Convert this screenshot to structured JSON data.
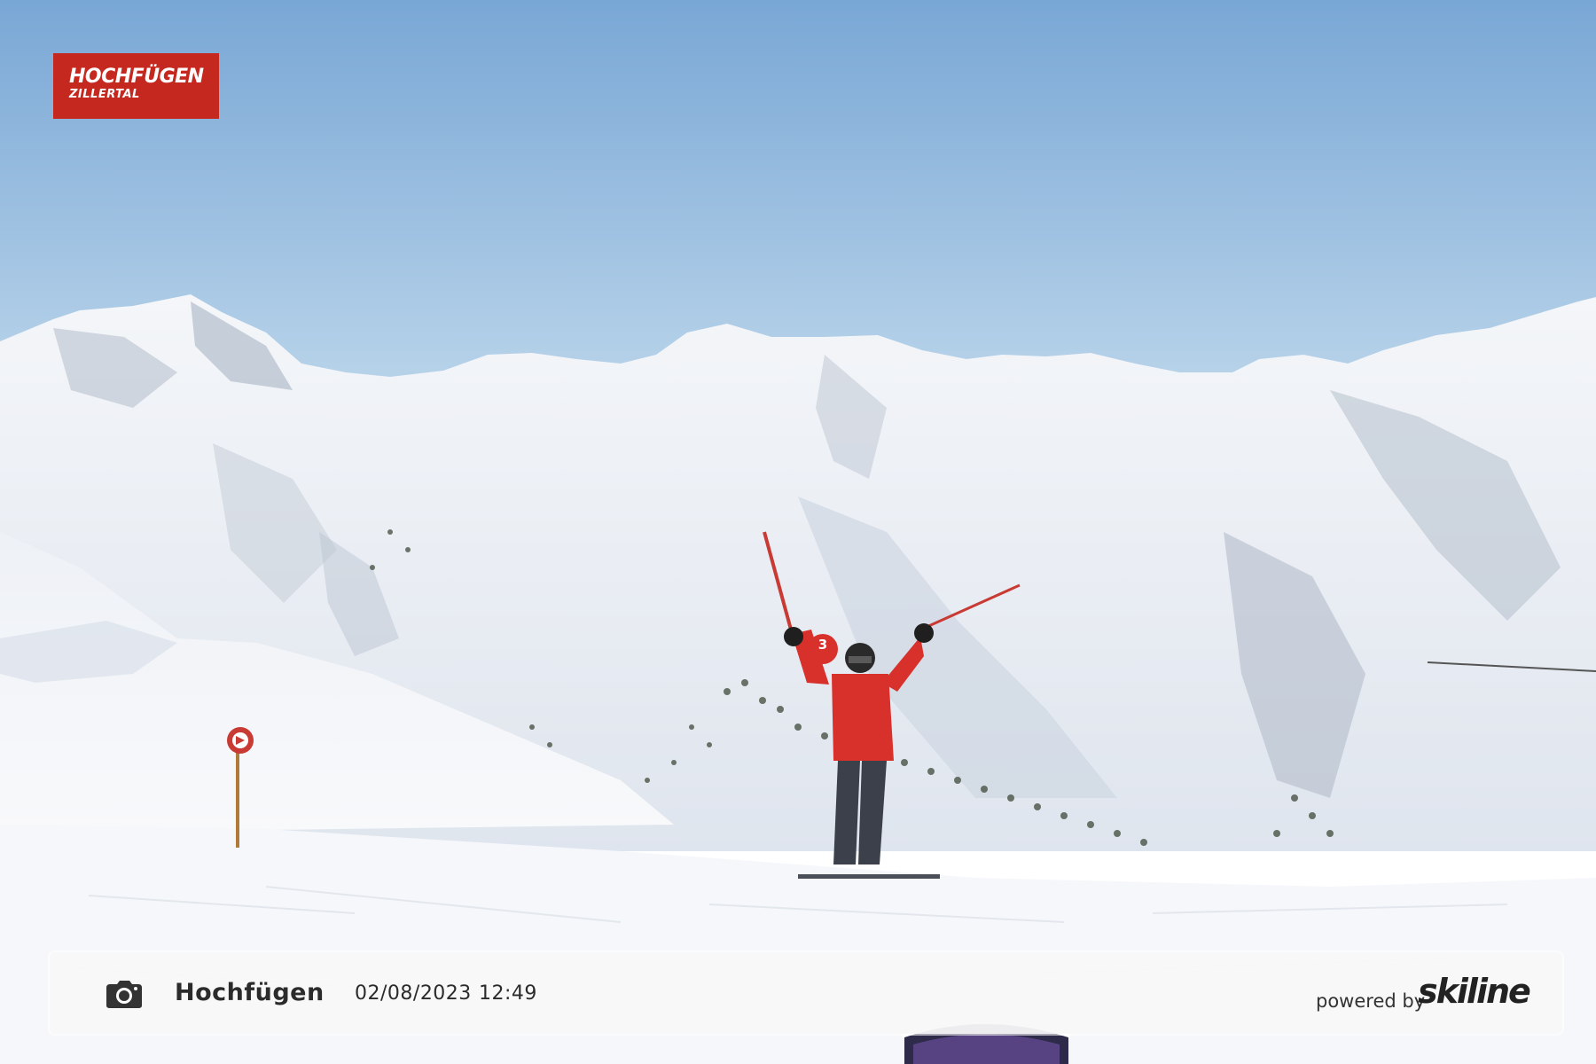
{
  "logo": {
    "line1": "HOCHFÜGEN",
    "line2": "ZILLERTAL"
  },
  "pole_sign": {
    "number": "3"
  },
  "info_bar": {
    "camera_icon": "camera-icon",
    "location": "Hochfügen",
    "date": "02/08/2023",
    "time": "12:49",
    "powered_by": "powered by",
    "brand": "skiline"
  },
  "colors": {
    "sky_top": "#7ba9d6",
    "sky_bottom": "#b8d4ea",
    "logo_red": "#c4281f",
    "jacket_red": "#d8302a"
  }
}
